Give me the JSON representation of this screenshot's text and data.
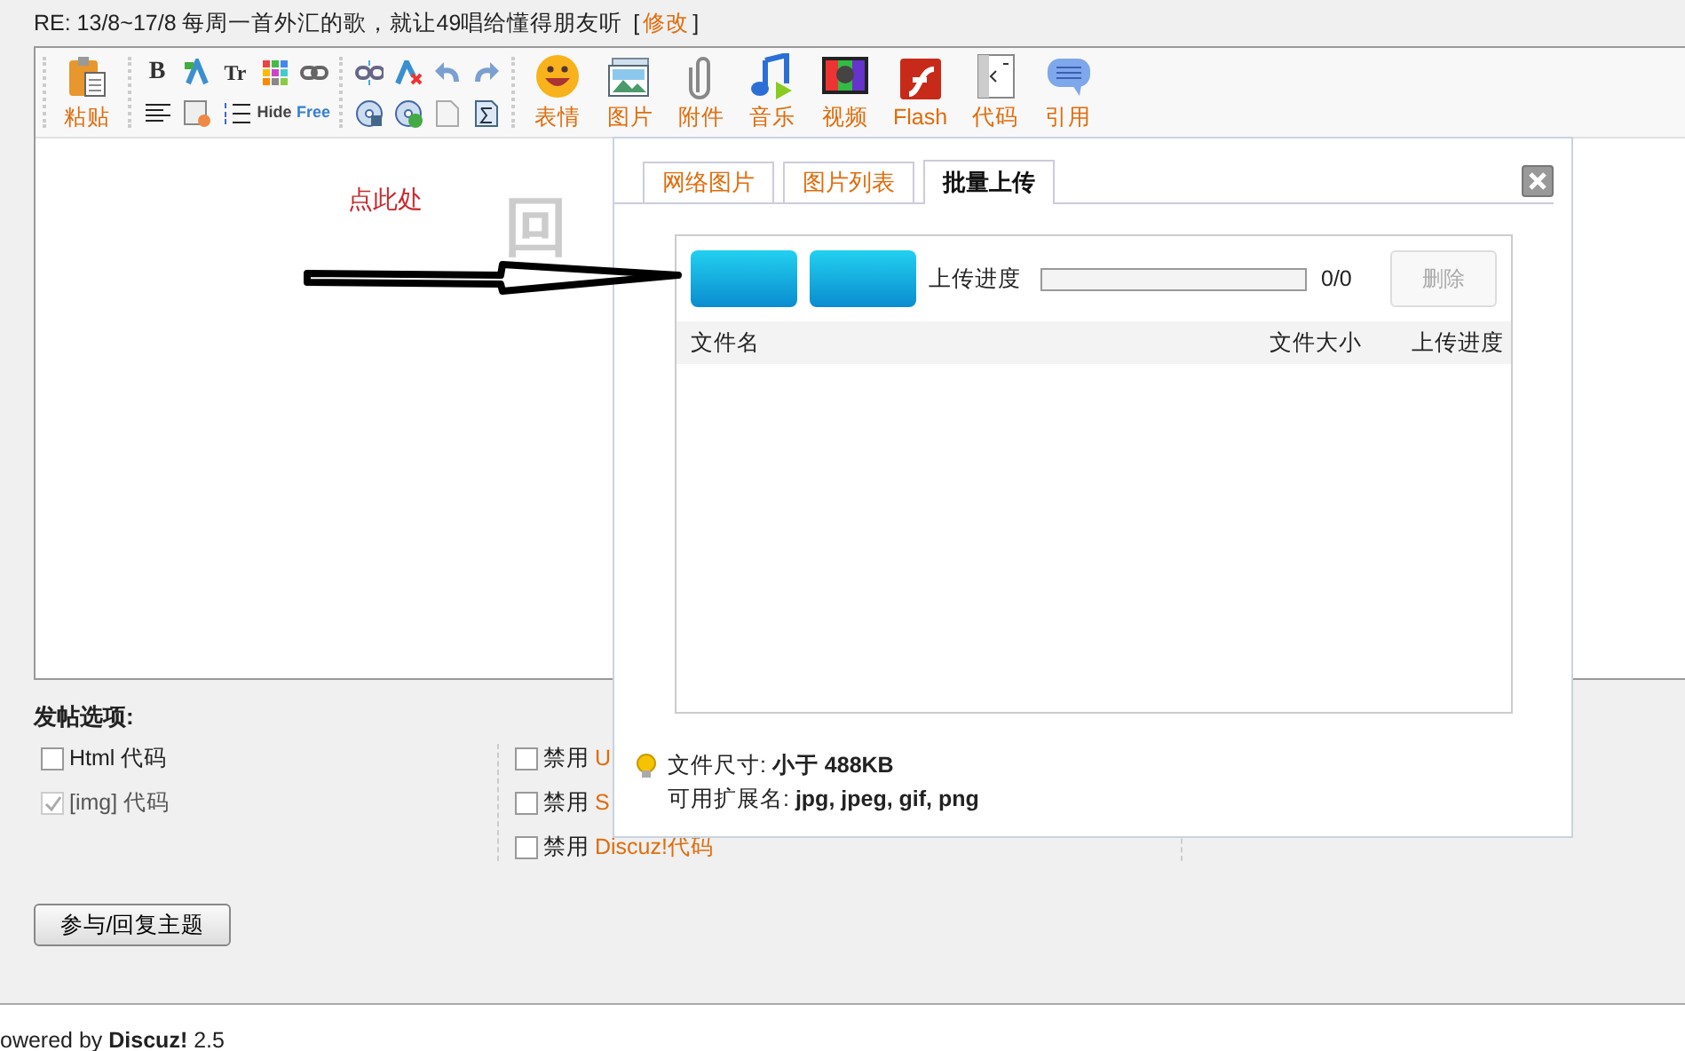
{
  "post_title": {
    "text": "RE: 13/8~17/8 每周一首外汇的歌，就让49唱给懂得朋友听",
    "bracket_open": "[",
    "edit_link": "修改",
    "bracket_close": "]"
  },
  "toolbar": {
    "paste_label": "粘贴",
    "format_groups": [
      [
        [
          {
            "kind": "bold",
            "glyph": "B"
          },
          {
            "kind": "font-color"
          },
          {
            "kind": "font-size",
            "glyph": "Tr"
          },
          {
            "kind": "color-grid"
          },
          {
            "kind": "link"
          }
        ],
        [
          {
            "kind": "align"
          },
          {
            "kind": "list"
          },
          {
            "kind": "ordered-list"
          },
          {
            "kind": "hide",
            "glyph": "Hide"
          },
          {
            "kind": "free",
            "glyph": "Free"
          }
        ]
      ],
      [
        [
          {
            "kind": "unlink"
          },
          {
            "kind": "clear-format"
          },
          {
            "kind": "undo"
          },
          {
            "kind": "redo"
          }
        ],
        [
          {
            "kind": "disc"
          },
          {
            "kind": "disc-play"
          },
          {
            "kind": "page"
          },
          {
            "kind": "sigma"
          }
        ]
      ]
    ],
    "insert_buttons": [
      {
        "kind": "smiley",
        "label": "表情"
      },
      {
        "kind": "image",
        "label": "图片"
      },
      {
        "kind": "clip",
        "label": "附件"
      },
      {
        "kind": "music",
        "label": "音乐"
      },
      {
        "kind": "tv",
        "label": "视频"
      },
      {
        "kind": "flash",
        "label": "Flash"
      },
      {
        "kind": "code",
        "label": "代码"
      },
      {
        "kind": "quote",
        "label": "引用"
      }
    ]
  },
  "editor": {
    "annotation": "点此处",
    "background_text": "回"
  },
  "options": {
    "title": "发帖选项:",
    "left": [
      {
        "label": "Html 代码",
        "checked": false,
        "disabled": false
      },
      {
        "label": "[img] 代码",
        "checked": true,
        "disabled": true
      }
    ],
    "right": [
      {
        "prefix": "禁用",
        "link": "U",
        "checked": false
      },
      {
        "prefix": "禁用",
        "link": "S",
        "checked": false
      },
      {
        "prefix": "禁用",
        "link": "Discuz!代码",
        "checked": false
      }
    ]
  },
  "submit_button": "参与/回复主题",
  "footer": "owered by **Discuz!** 2.5",
  "upload_dialog": {
    "tabs": [
      {
        "label": "网络图片",
        "selected": false
      },
      {
        "label": "图片列表",
        "selected": false
      },
      {
        "label": "批量上传",
        "selected": true
      }
    ],
    "progress_label": "上传进度",
    "level": 0,
    "count": "0/0",
    "delete_button": {
      "label": "删除",
      "disabled": true
    },
    "columns": [
      "文件名",
      "文件大小",
      "上传进度"
    ],
    "tips": [
      "文件尺寸: **小于  488KB**",
      "可用扩展名: **jpg, jpeg, gif, png**"
    ]
  }
}
